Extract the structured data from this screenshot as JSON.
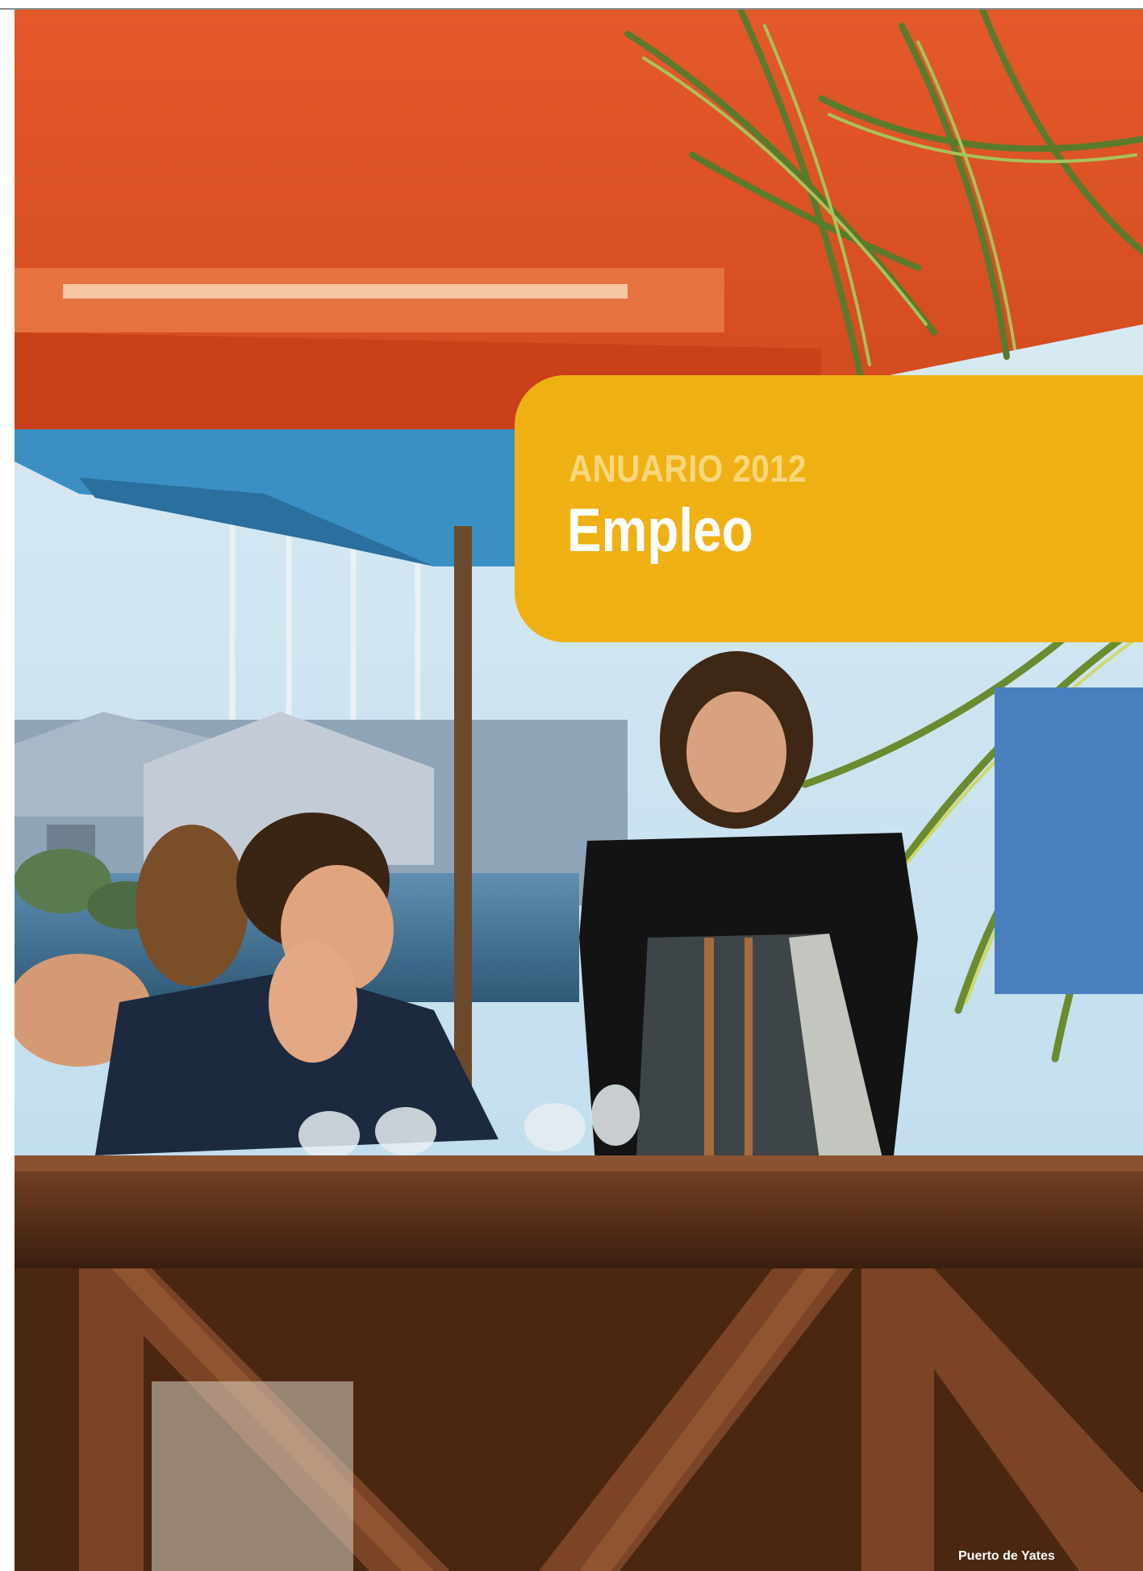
{
  "cover": {
    "kicker": "ANUARIO 2012",
    "title": "Empleo",
    "photo_caption": "Puerto de Yates"
  },
  "colors": {
    "title_box": "#efb014",
    "kicker_text": "#f8d77c",
    "title_text": "#ffffff"
  },
  "photo": {
    "subject": "outdoor cafe terrace with waitress serving seated customers at a marina"
  }
}
